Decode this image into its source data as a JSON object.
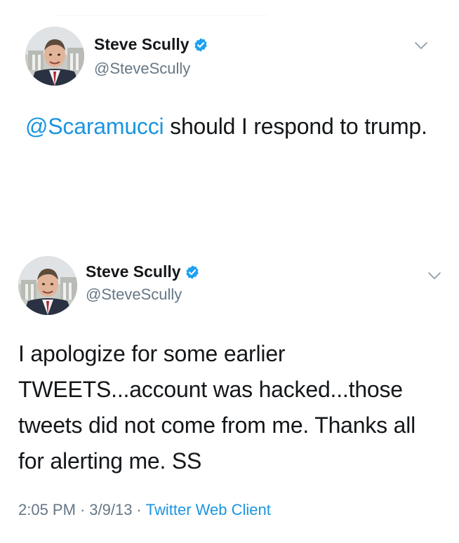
{
  "tweets": [
    {
      "author": {
        "display_name": "Steve Scully",
        "handle": "@SteveScully",
        "verified": true,
        "avatar_icon": "profile-photo"
      },
      "mention": "@Scaramucci",
      "text_after_mention": " should I respond to trump."
    },
    {
      "author": {
        "display_name": "Steve Scully",
        "handle": "@SteveScully",
        "verified": true,
        "avatar_icon": "profile-photo"
      },
      "text": "I apologize for some earlier TWEETS...account was hacked...those tweets did not come from me.  Thanks all for alerting me.  SS",
      "time": "2:05 PM",
      "date": "3/9/13",
      "client": "Twitter Web Client",
      "separator": "·"
    }
  ],
  "colors": {
    "link_blue": "#1b95e0",
    "secondary_gray": "#657786",
    "text_black": "#14171a",
    "verified_blue": "#1da1f2"
  },
  "icons": {
    "verified": "verified-badge-icon",
    "menu": "chevron-down-icon"
  }
}
